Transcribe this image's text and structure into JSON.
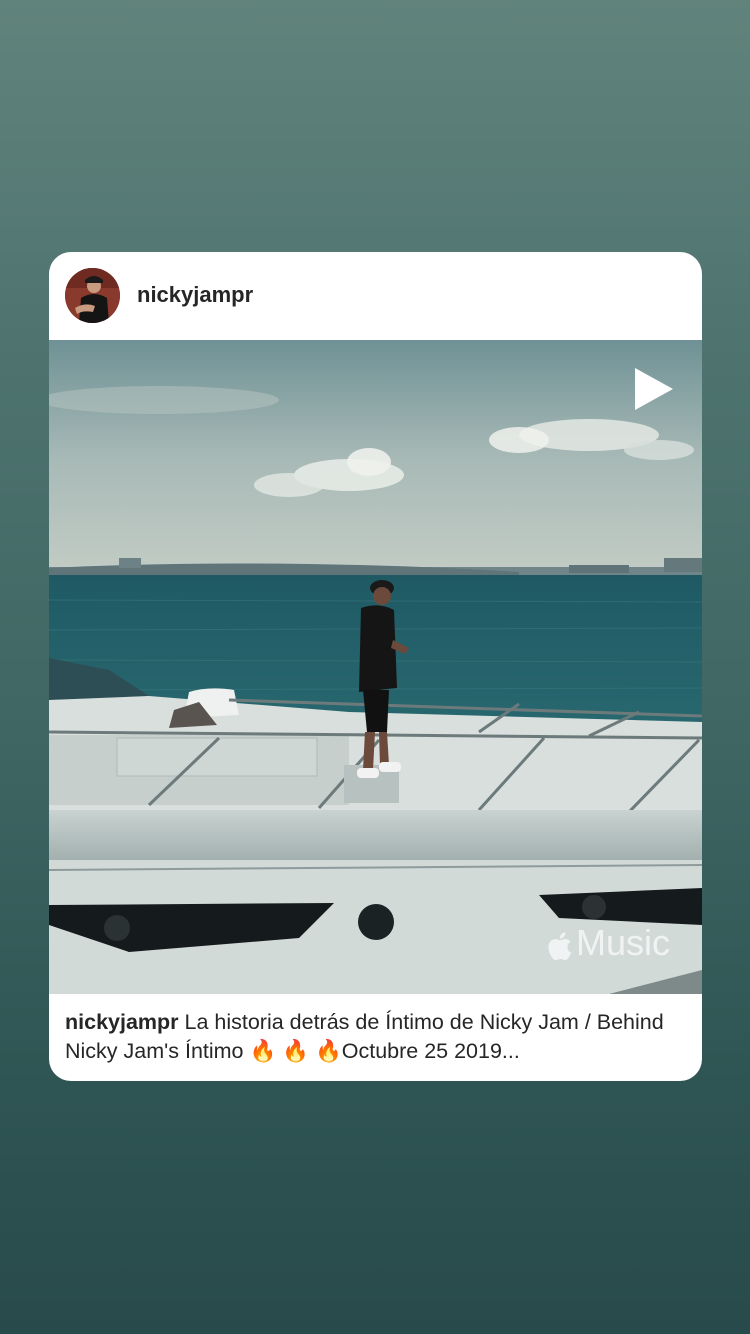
{
  "post": {
    "username": "nickyjampr",
    "caption_user": "nickyjampr",
    "caption_text": " La historia detrás de Íntimo de Nicky Jam / Behind Nicky Jam's Íntimo 🔥 🔥 🔥Octubre 25 2019...",
    "watermark": "Music",
    "media_type": "video"
  },
  "icons": {
    "play": "play-icon",
    "avatar": "avatar",
    "brand": "apple-logo-icon"
  },
  "colors": {
    "background_top": "#61837c",
    "background_bottom": "#284a4b",
    "card": "#ffffff",
    "text": "#262626"
  }
}
